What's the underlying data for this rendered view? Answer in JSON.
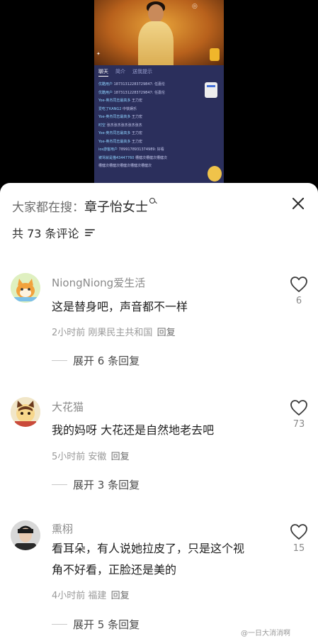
{
  "video": {
    "tabs": [
      "聊天",
      "简介",
      "送我提示"
    ],
    "chat_messages": [
      {
        "user": "优酷用户",
        "text": "18731312283729847: 任嘉伦"
      },
      {
        "user": "优酷用户",
        "text": "18731312283729847: 任嘉伦"
      },
      {
        "user": "Yoe-英杰同志最高多",
        "text": "王力宏"
      },
      {
        "user": "爱吃了KANG2",
        "text": "中铁娱乐"
      },
      {
        "user": "Yoe-英杰同志最高多",
        "text": "王力宏"
      },
      {
        "user": "时空",
        "text": "张杰张杰张杰张杰张杰"
      },
      {
        "user": "Yoe-英杰同志最高多",
        "text": "王力宏"
      },
      {
        "user": "Yoe-英杰同志最高多",
        "text": "王力宏"
      },
      {
        "user": "ios游客用户",
        "text": "7899178931374989: 好看"
      },
      {
        "user": "被骂就是猫43447760",
        "text": "槽健次槽健次槽健次"
      },
      {
        "user": "",
        "text": "槽健次槽健次槽健次槽健次槽健次"
      }
    ]
  },
  "search": {
    "prefix": "大家都在搜：",
    "keyword": "章子怡女士"
  },
  "comments_header": {
    "count_text": "共 73 条评论"
  },
  "comments": [
    {
      "username": "NiongNiong爱生活",
      "lines": [
        "这是替身吧，声音都不一样"
      ],
      "time": "2小时前",
      "location": "刚果民主共和国",
      "reply_label": "回复",
      "expand_text": "展开 6 条回复",
      "likes": "6"
    },
    {
      "username": "大花猫",
      "lines": [
        "我的妈呀 大花还是自然地老去吧"
      ],
      "time": "5小时前",
      "location": "安徽",
      "reply_label": "回复",
      "expand_text": "展开 3 条回复",
      "likes": "73"
    },
    {
      "username": "熏栩",
      "lines": [
        "看耳朵，有人说她拉皮了，只是这个视",
        "角不好看，正脸还是美的"
      ],
      "time": "4小时前",
      "location": "福建",
      "reply_label": "回复",
      "expand_text": "展开 5 条回复",
      "likes": "15"
    }
  ],
  "watermark": "@一日大消消啊",
  "icons": {
    "close": "close-icon",
    "sort": "sort-icon",
    "like": "heart-icon",
    "search": "search-icon"
  }
}
